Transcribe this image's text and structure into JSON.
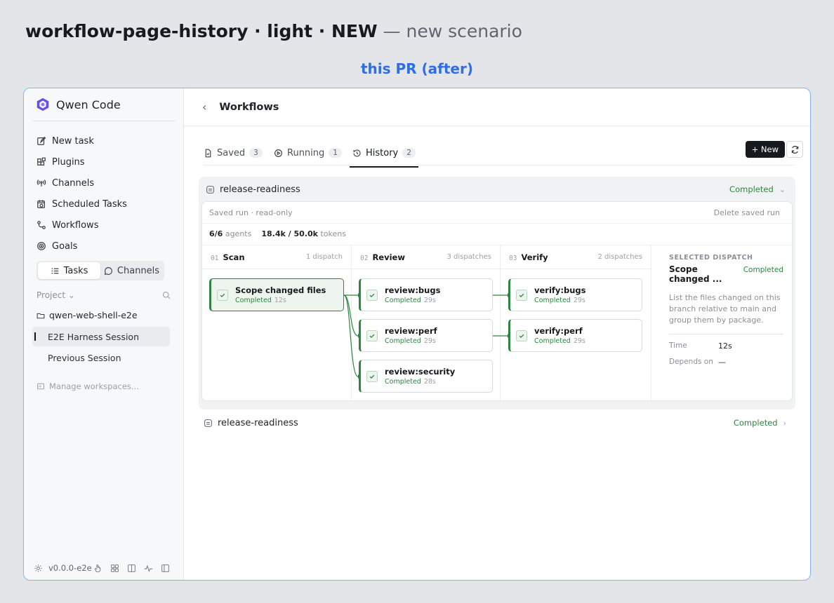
{
  "scenario": {
    "title": "workflow-page-history · light · NEW",
    "dash": "—",
    "subtitle": "new scenario"
  },
  "pr_label": "this PR (after)",
  "sidebar": {
    "app_name": "Qwen Code",
    "nav": [
      {
        "label": "New task",
        "icon": "pencil-square-icon"
      },
      {
        "label": "Plugins",
        "icon": "plugins-icon"
      },
      {
        "label": "Channels",
        "icon": "broadcast-icon"
      },
      {
        "label": "Scheduled Tasks",
        "icon": "calendar-clock-icon"
      },
      {
        "label": "Workflows",
        "icon": "workflow-icon"
      },
      {
        "label": "Goals",
        "icon": "target-icon"
      }
    ],
    "segment": {
      "tasks": "Tasks",
      "channels": "Channels"
    },
    "project_label": "Project",
    "project_folder": "qwen-web-shell-e2e",
    "sessions": [
      "E2E Harness Session",
      "Previous Session"
    ],
    "manage": "Manage workspaces...",
    "version": "v0.0.0-e2e"
  },
  "main": {
    "title": "Workflows",
    "back_icon": "‹",
    "tabs": [
      {
        "label": "Saved",
        "count": "3"
      },
      {
        "label": "Running",
        "count": "1"
      },
      {
        "label": "History",
        "count": "2"
      }
    ],
    "new_button": "+ New",
    "run": {
      "name": "release-readiness",
      "status": "Completed",
      "saved_note": "Saved run · read-only",
      "delete": "Delete saved run",
      "agents_value": "6/6",
      "agents_label": "agents",
      "tokens_value": "18.4k / 50.0k",
      "tokens_label": "tokens",
      "stages": [
        {
          "num": "01",
          "name": "Scan",
          "dispatch": "1 dispatch"
        },
        {
          "num": "02",
          "name": "Review",
          "dispatch": "3 dispatches"
        },
        {
          "num": "03",
          "name": "Verify",
          "dispatch": "2 dispatches"
        }
      ],
      "nodes": [
        {
          "title": "Scope changed files",
          "status": "Completed",
          "dur": "12s"
        },
        {
          "title": "review:bugs",
          "status": "Completed",
          "dur": "29s"
        },
        {
          "title": "review:perf",
          "status": "Completed",
          "dur": "29s"
        },
        {
          "title": "review:security",
          "status": "Completed",
          "dur": "28s"
        },
        {
          "title": "verify:bugs",
          "status": "Completed",
          "dur": "29s"
        },
        {
          "title": "verify:perf",
          "status": "Completed",
          "dur": "29s"
        }
      ],
      "detail": {
        "label": "SELECTED DISPATCH",
        "title": "Scope changed ...",
        "status": "Completed",
        "desc": "List the files changed on this branch relative to main and group them by package.",
        "time_label": "Time",
        "time_value": "12s",
        "depends_label": "Depends on",
        "depends_value": "—"
      }
    },
    "run2": {
      "name": "release-readiness",
      "status": "Completed"
    }
  },
  "colors": {
    "accent_green": "#2e8540",
    "pr_blue": "#2f6fe0",
    "frame_border": "#7fb4ee"
  }
}
